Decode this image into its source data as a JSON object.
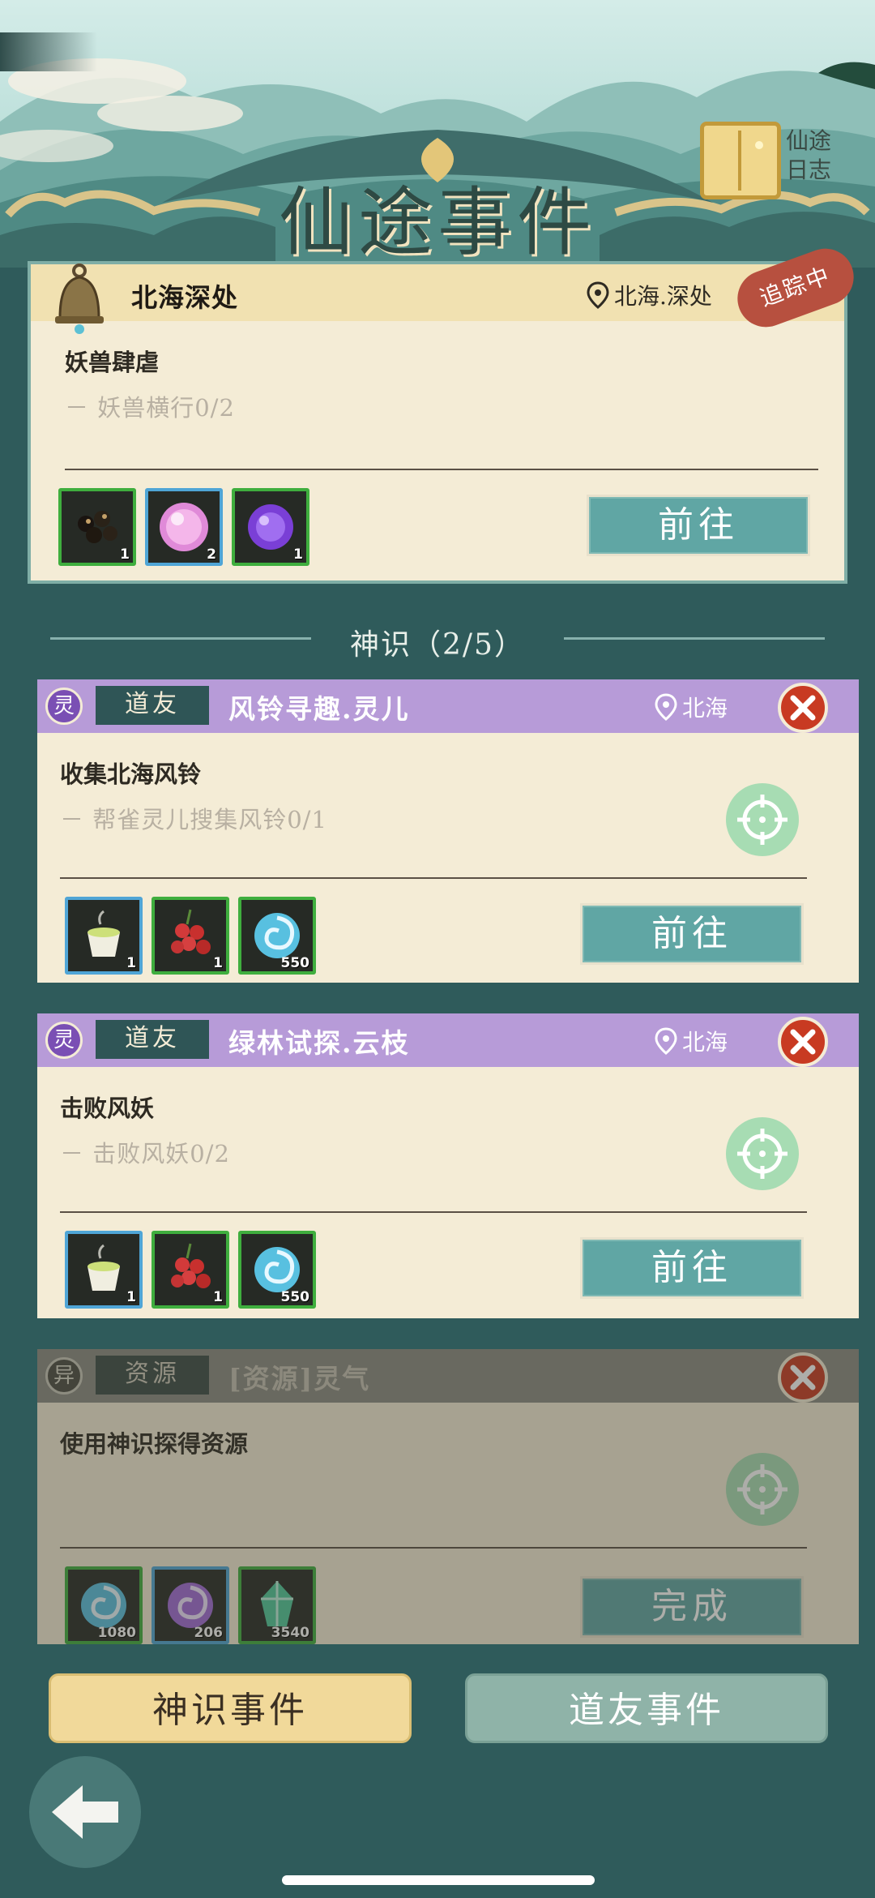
{
  "header": {
    "title": "仙途事件",
    "journal_label_line1": "仙途",
    "journal_label_line2": "日志"
  },
  "main_quest": {
    "title": "北海深处",
    "location": "北海.深处",
    "tracking_tag": "追踪中",
    "objective": "妖兽肆虐",
    "progress_text": "－ 妖兽横行0/2",
    "rewards": [
      {
        "icon": "black-beans-icon",
        "qty": "1"
      },
      {
        "icon": "pink-orb-icon",
        "qty": "2"
      },
      {
        "icon": "purple-orb-icon",
        "qty": "1"
      }
    ],
    "go_label": "前往"
  },
  "section": {
    "title": "神识（2/5）"
  },
  "tasks": [
    {
      "badge": "灵",
      "type": "道友",
      "name": "风铃寻趣.灵儿",
      "location": "北海",
      "objective": "收集北海风铃",
      "progress_text": "－ 帮雀灵儿搜集风铃0/1",
      "rewards": [
        {
          "icon": "tea-cup-icon",
          "qty": "1"
        },
        {
          "icon": "red-berries-icon",
          "qty": "1"
        },
        {
          "icon": "blue-swirl-icon",
          "qty": "550"
        }
      ],
      "action_label": "前往"
    },
    {
      "badge": "灵",
      "type": "道友",
      "name": "绿林试探.云枝",
      "location": "北海",
      "objective": "击败风妖",
      "progress_text": "－ 击败风妖0/2",
      "rewards": [
        {
          "icon": "tea-cup-icon",
          "qty": "1"
        },
        {
          "icon": "red-berries-icon",
          "qty": "1"
        },
        {
          "icon": "blue-swirl-icon",
          "qty": "550"
        }
      ],
      "action_label": "前往"
    },
    {
      "badge": "异",
      "type": "资源",
      "name": "[资源]灵气",
      "objective": "使用神识探得资源",
      "rewards": [
        {
          "icon": "blue-swirl-icon",
          "qty": "1080"
        },
        {
          "icon": "purple-swirl-icon",
          "qty": "206"
        },
        {
          "icon": "green-crystal-icon",
          "qty": "3540"
        }
      ],
      "action_label": "完成"
    }
  ],
  "bottom": {
    "left_button": "神识事件",
    "right_button": "道友事件"
  },
  "colors": {
    "background": "#2f5b5b",
    "card": "#f4ecd6",
    "task_header": "#b79bd8",
    "go_button": "#60a6a4",
    "close_red": "#c83a22"
  }
}
